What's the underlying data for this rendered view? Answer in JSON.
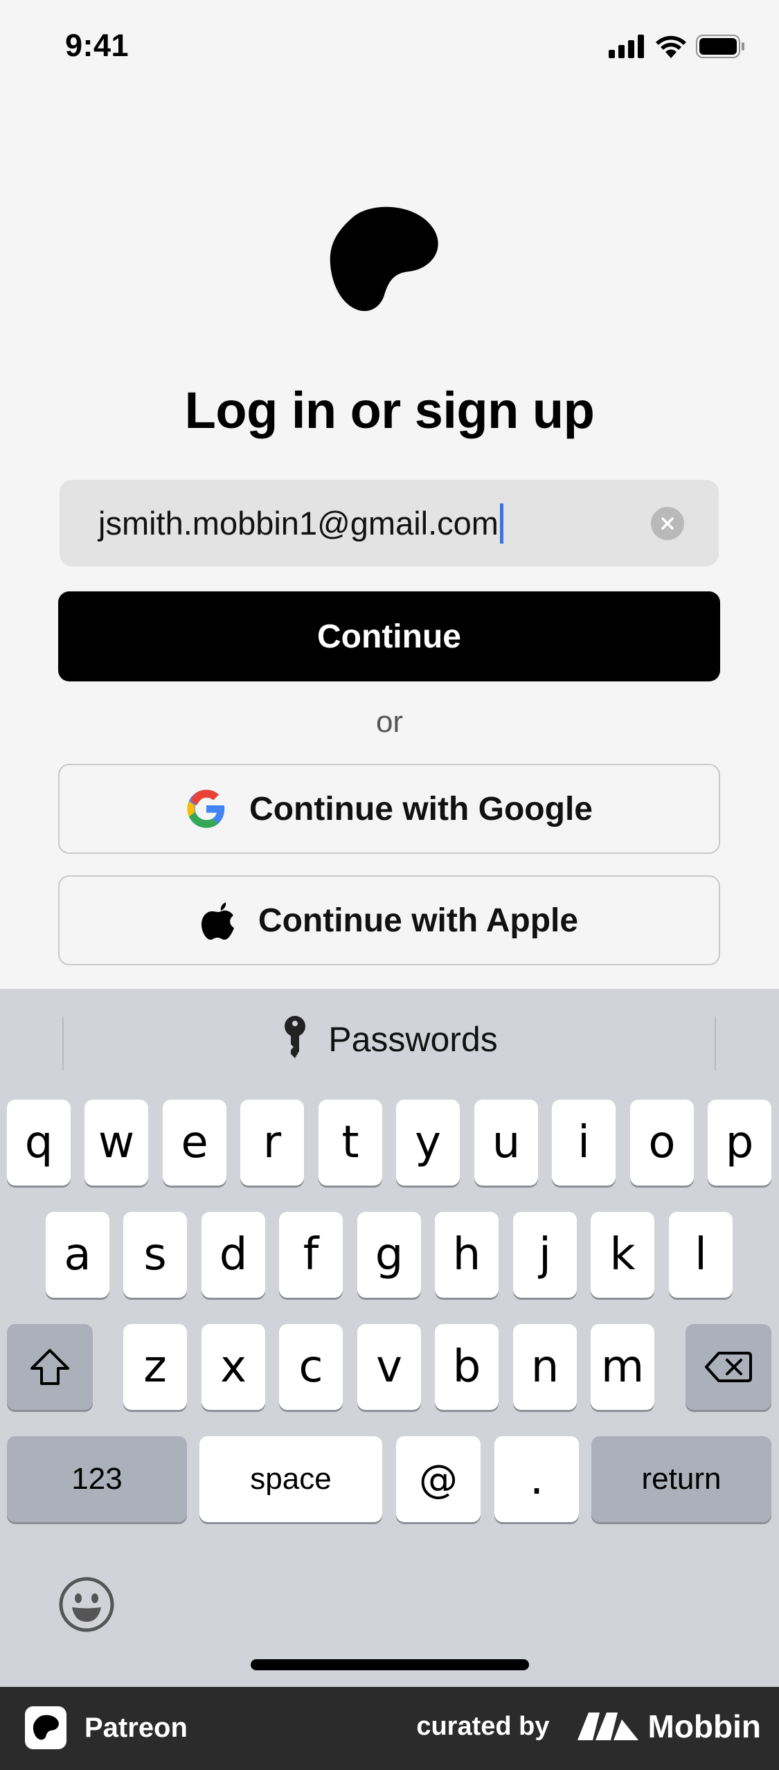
{
  "status_bar": {
    "time": "9:41"
  },
  "title": "Log in or sign up",
  "email": {
    "value": "jsmith.mobbin1@gmail.com"
  },
  "buttons": {
    "continue": "Continue",
    "or": "or",
    "google": "Continue with Google",
    "apple": "Continue with Apple"
  },
  "keyboard": {
    "passwords_label": "Passwords",
    "row1": [
      "q",
      "w",
      "e",
      "r",
      "t",
      "y",
      "u",
      "i",
      "o",
      "p"
    ],
    "row2": [
      "a",
      "s",
      "d",
      "f",
      "g",
      "h",
      "j",
      "k",
      "l"
    ],
    "row3": [
      "z",
      "x",
      "c",
      "v",
      "b",
      "n",
      "m"
    ],
    "numbers": "123",
    "space": "space",
    "at": "@",
    "dot": ".",
    "return": "return"
  },
  "footer": {
    "app_name": "Patreon",
    "curated_by": "curated by",
    "brand": "Mobbin"
  },
  "icons": {
    "signal": "signal-icon",
    "wifi": "wifi-icon",
    "battery": "battery-icon",
    "logo": "patreon-logo-icon",
    "clear": "clear-icon",
    "google": "google-icon",
    "apple": "apple-icon",
    "key": "key-icon",
    "shift": "shift-icon",
    "delete": "backspace-icon",
    "emoji": "emoji-icon",
    "mobbin": "mobbin-logo-icon"
  },
  "colors": {
    "primary": "#000000",
    "caret": "#3a73e0",
    "background": "#f5f5f5",
    "keyboard": "#d1d3d9"
  }
}
